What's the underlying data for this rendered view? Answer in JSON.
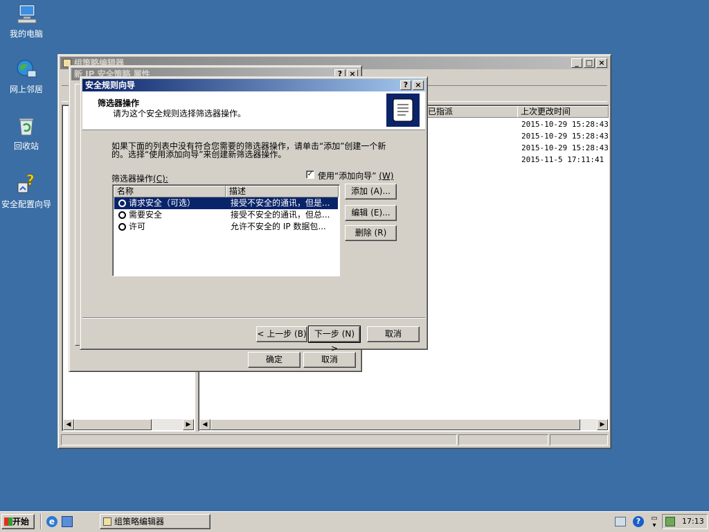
{
  "desktop": {
    "icons": [
      {
        "label": "我的电脑"
      },
      {
        "label": "网上邻居"
      },
      {
        "label": "回收站"
      },
      {
        "label": "安全配置向导"
      }
    ]
  },
  "gpo_window": {
    "title": "组策略编辑器",
    "columns": [
      "已指派",
      "上次更改时间"
    ],
    "timestamps": [
      "2015-10-29 15:28:43",
      "2015-10-29 15:28:43",
      "2015-10-29 15:28:43",
      "2015-11-5 17:11:41"
    ]
  },
  "props_dialog": {
    "title": "新 IP 安全策略 属性",
    "ok": "确定",
    "cancel": "取消"
  },
  "wizard": {
    "title": "安全规则向导",
    "header_title": "筛选器操作",
    "header_sub": "请为这个安全规则选择筛选器操作。",
    "intro_line1": "如果下面的列表中没有符合您需要的筛选器操作，请单击“添加”创建一个新",
    "intro_line2": "的。选择“使用添加向导”来创建新筛选器操作。",
    "list_label": "筛选器操作",
    "list_label_key": "(C):",
    "use_wizard_label": "使用“添加向导”",
    "use_wizard_key": "(W)",
    "use_wizard_checked": true,
    "col_name": "名称",
    "col_desc": "描述",
    "rows": [
      {
        "name": "请求安全（可选）",
        "desc": "接受不安全的通讯，但是...",
        "selected": true
      },
      {
        "name": "需要安全",
        "desc": "接受不安全的通讯，但总...",
        "selected": false
      },
      {
        "name": "许可",
        "desc": "允许不安全的 IP 数据包...",
        "selected": false
      }
    ],
    "add_btn": "添加 (A)...",
    "edit_btn": "编辑 (E)...",
    "remove_btn": "删除 (R)",
    "back_btn": "< 上一步 (B)",
    "next_btn": "下一步 (N) >",
    "cancel_btn": "取消"
  },
  "taskbar": {
    "start": "开始",
    "task_label": "组策略编辑器",
    "clock": "17:13"
  }
}
